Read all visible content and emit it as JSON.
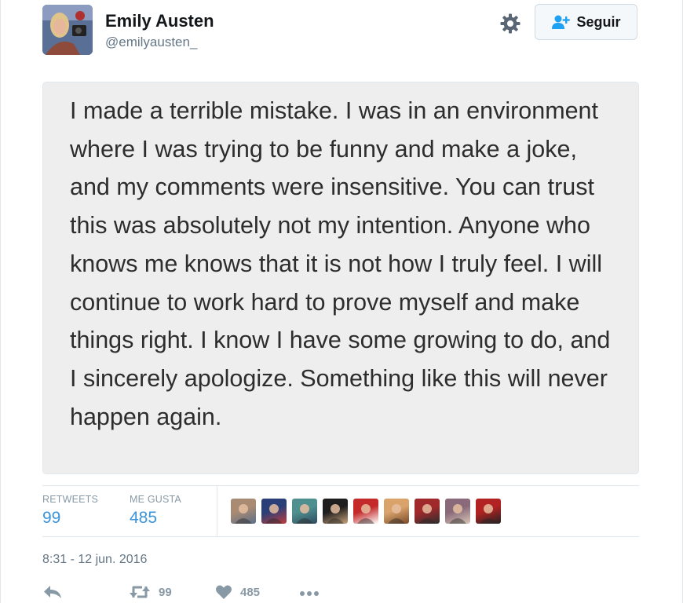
{
  "user": {
    "name": "Emily Austen",
    "handle": "@emilyausten_"
  },
  "header": {
    "follow_label": "Seguir",
    "settings_icon": "gear-icon",
    "follow_icon": "add-user-icon"
  },
  "tweet": {
    "image_text": "I made a terrible mistake. I was in an environment where I was trying to be funny and make a joke, and my comments were insensitive. You can trust this was absolutely not my intention. Anyone who knows me knows that it is not how I truly feel.  I will continue to work hard to prove myself and make things right. I know I have some growing to do, and I sincerely apologize. Something like this will never happen again.",
    "timestamp": "8:31 - 12 jun. 2016"
  },
  "stats": {
    "retweets_label": "RETWEETS",
    "retweets_value": "99",
    "likes_label": "ME GUSTA",
    "likes_value": "485",
    "liker_avatars": [
      {
        "color_a": "#a98b73",
        "color_b": "#5c6e8a"
      },
      {
        "color_a": "#2a3f78",
        "color_b": "#c23b3b"
      },
      {
        "color_a": "#4f8f8f",
        "color_b": "#2f4b5e"
      },
      {
        "color_a": "#1e1e1e",
        "color_b": "#c8a37a"
      },
      {
        "color_a": "#c42a2a",
        "color_b": "#ffffff"
      },
      {
        "color_a": "#d9a36b",
        "color_b": "#7a4a2a"
      },
      {
        "color_a": "#a0292b",
        "color_b": "#2e2e2e"
      },
      {
        "color_a": "#8a6a7a",
        "color_b": "#d6c6b6"
      },
      {
        "color_a": "#b22222",
        "color_b": "#222222"
      }
    ]
  },
  "actions": {
    "reply_icon": "reply-icon",
    "retweet_icon": "retweet-icon",
    "retweet_count": "99",
    "like_icon": "heart-icon",
    "like_count": "485",
    "more_icon": "more-icon"
  },
  "colors": {
    "accent": "#3b94d9",
    "muted": "#8899a6",
    "follow_icon": "#1da1f2"
  }
}
